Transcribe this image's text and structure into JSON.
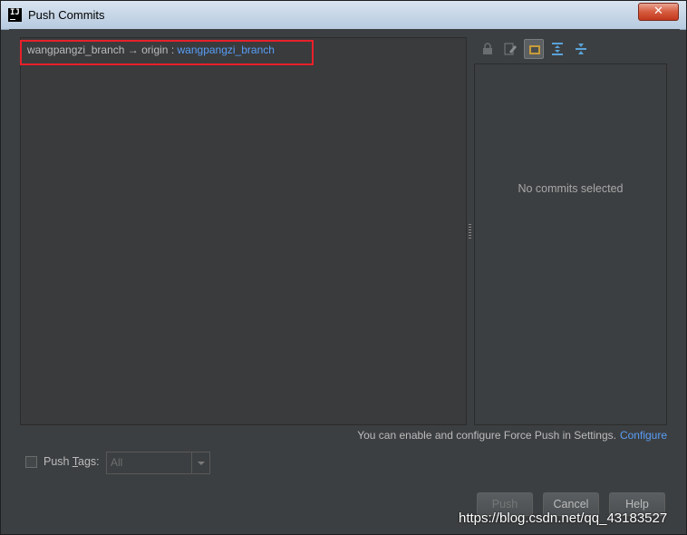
{
  "window": {
    "title": "Push Commits",
    "app_icon": "IJ",
    "close_icon": "close-icon"
  },
  "push_tree": {
    "source_branch": "wangpangzi_branch",
    "arrow": "→",
    "remote": "origin",
    "separator": ":",
    "target_branch": "wangpangzi_branch"
  },
  "details_toolbar": [
    "lock-icon",
    "edit-icon",
    "preview-icon",
    "expand-all-icon",
    "collapse-all-icon"
  ],
  "details_panel": {
    "empty_text": "No commits selected"
  },
  "force_push_hint": {
    "text": "You can enable and configure Force Push in Settings.",
    "link": "Configure"
  },
  "push_tags": {
    "label_prefix": "Push ",
    "label_mnemonic": "T",
    "label_suffix": "ags:",
    "checked": false,
    "selected_option": "All"
  },
  "buttons": {
    "push": "Push",
    "cancel": "Cancel",
    "help": "Help"
  },
  "watermark": "https://blog.csdn.net/qq_43183527",
  "colors": {
    "link": "#589df6",
    "highlight": "#e8202a",
    "background": "#3c3f41"
  }
}
